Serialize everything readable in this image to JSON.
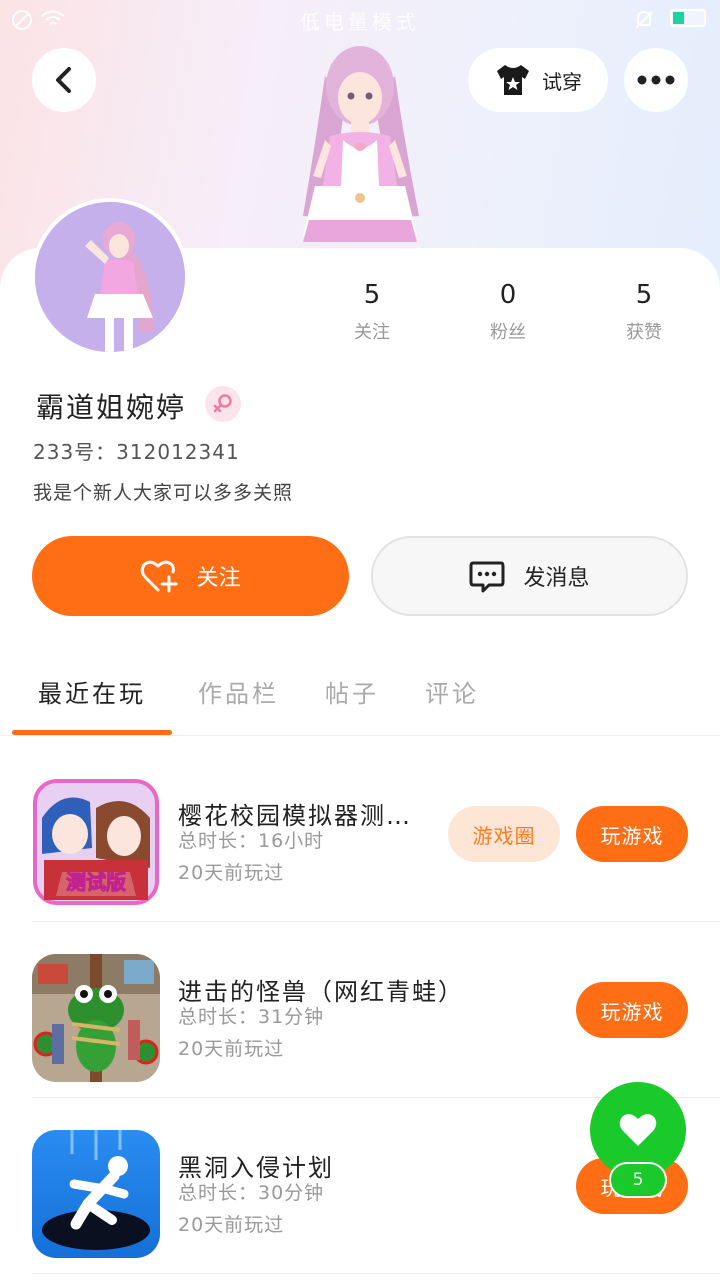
{
  "status_bar": {
    "title": "低电量模式"
  },
  "header": {
    "try_on_label": "试穿"
  },
  "profile": {
    "stats": [
      {
        "num": "5",
        "label": "关注"
      },
      {
        "num": "0",
        "label": "粉丝"
      },
      {
        "num": "5",
        "label": "获赞"
      }
    ],
    "username": "霸道姐婉婷",
    "uid": "233号：312012341",
    "bio": "我是个新人大家可以多多关照"
  },
  "actions": {
    "follow_label": "关注",
    "message_label": "发消息"
  },
  "tabs": [
    "最近在玩",
    "作品栏",
    "帖子",
    "评论"
  ],
  "games": [
    {
      "name": "樱花校园模拟器测…",
      "duration": "总时长：16小时",
      "last": "20天前玩过",
      "circle_label": "游戏圈",
      "play_label": "玩游戏",
      "icon_text": "测试版"
    },
    {
      "name": "进击的怪兽（网红青蛙）",
      "duration": "总时长：31分钟",
      "last": "20天前玩过",
      "play_label": "玩游戏"
    },
    {
      "name": "黑洞入侵计划",
      "duration": "总时长：30分钟",
      "last": "20天前玩过",
      "play_label": "玩游戏"
    }
  ],
  "like_fab": {
    "count": "5"
  },
  "colors": {
    "accent": "#ff6e14",
    "like": "#1ac92a"
  }
}
